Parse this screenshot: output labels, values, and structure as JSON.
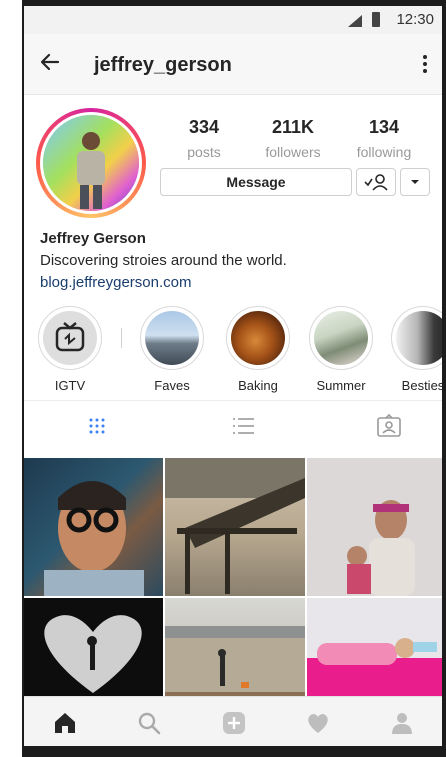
{
  "status_bar": {
    "time": "12:30"
  },
  "header": {
    "username": "jeffrey_gerson"
  },
  "profile": {
    "stats": [
      {
        "value": "334",
        "label": "posts"
      },
      {
        "value": "211K",
        "label": "followers"
      },
      {
        "value": "134",
        "label": "following"
      }
    ],
    "message_label": "Message",
    "bio_name": "Jeffrey Gerson",
    "bio_text": "Discovering stroies around the world.",
    "bio_link": "blog.jeffreygerson.com"
  },
  "highlights": [
    {
      "label": "IGTV",
      "icon": "igtv-icon"
    },
    {
      "label": "Faves"
    },
    {
      "label": "Baking"
    },
    {
      "label": "Summer"
    },
    {
      "label": "Besties"
    }
  ],
  "tabs": [
    "grid-icon",
    "list-icon",
    "tagged-icon"
  ],
  "bottom_nav": [
    "home-icon",
    "search-icon",
    "add-icon",
    "heart-icon",
    "profile-icon"
  ],
  "colors": {
    "accent_link": "#1a3d6e",
    "ring_gradient": [
      "#d6249f",
      "#fd5949",
      "#fdc468"
    ],
    "active_tab": "#3b82f6"
  }
}
